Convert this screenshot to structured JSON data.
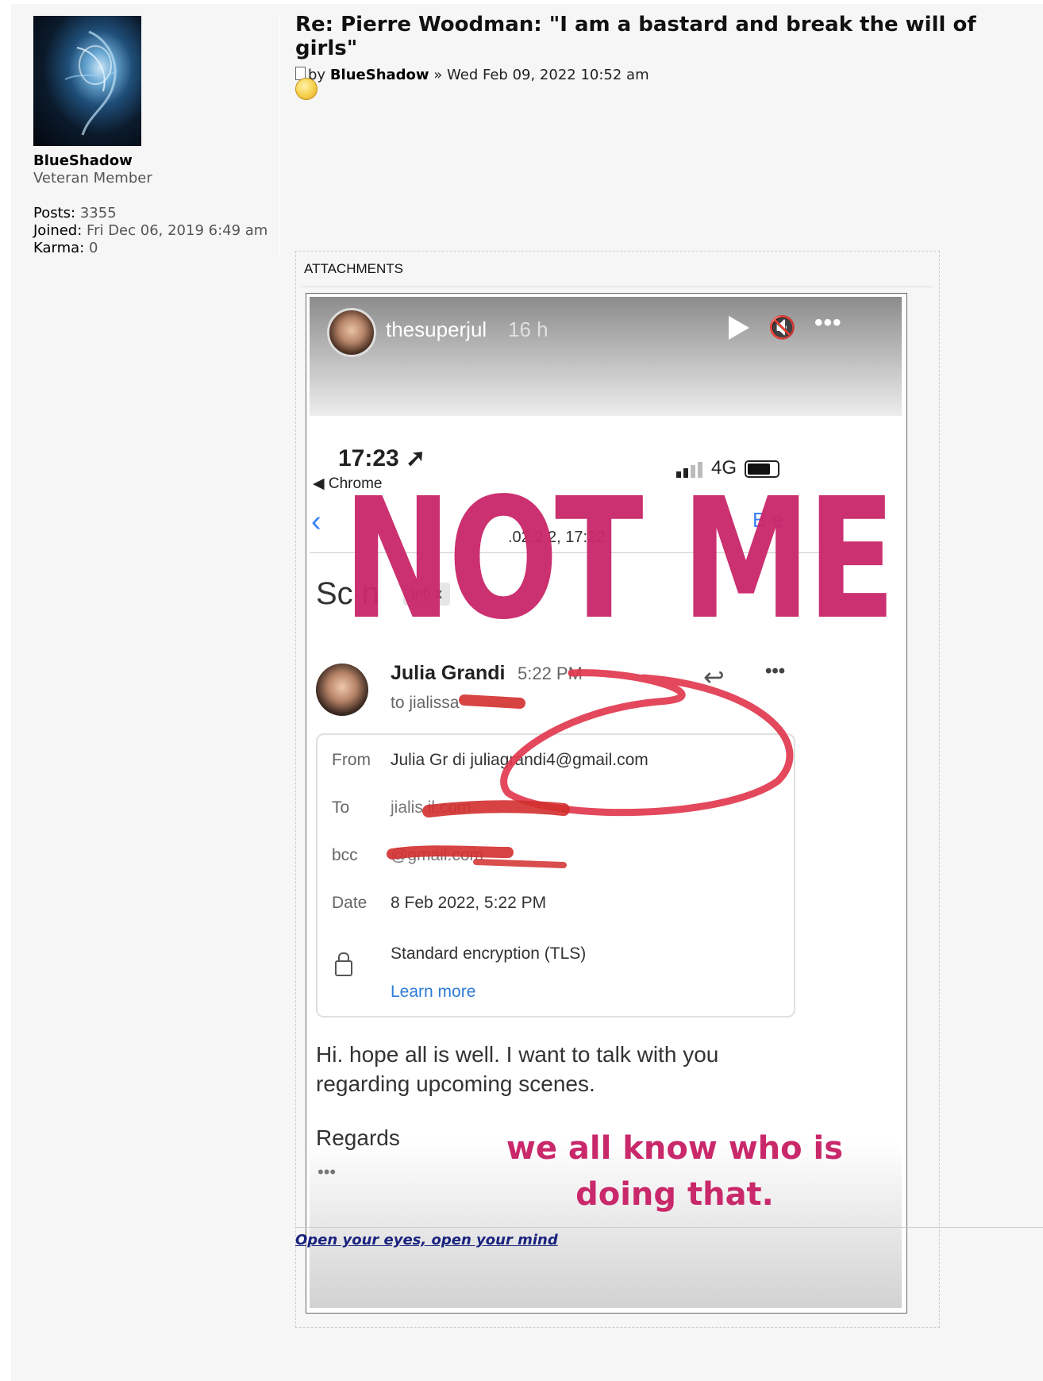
{
  "user": {
    "name": "BlueShadow",
    "rank": "Veteran Member",
    "posts_label": "Posts:",
    "posts_value": "3355",
    "joined_label": "Joined:",
    "joined_value": "Fri Dec 06, 2019 6:49 am",
    "karma_label": "Karma:",
    "karma_value": "0"
  },
  "post": {
    "title": "Re: Pierre Woodman: \"I am a bastard and break the will of girls\"",
    "by_prefix": "by",
    "author": "BlueShadow",
    "date_sep": "»",
    "date": "Wed Feb 09, 2022 10:52 am"
  },
  "attachments": {
    "label": "ATTACHMENTS",
    "story": {
      "username": "thesuperjul",
      "age": "16 h",
      "phone_time": "17:23",
      "back_app": "◀ Chrome",
      "network": "4G",
      "header_sub": ".02.2  2, 17:22",
      "header_right": "B  e",
      "subject_partial": "Sc  n",
      "inbox_tag": "Inb  x",
      "overlay": "NOT ME",
      "sender_name": "Julia Grandi",
      "sender_time": "5:22 PM",
      "to_line": "to jialissa",
      "from_label": "From",
      "from_value": "Julia Gr  di   juliagrandi4@gmail.com",
      "to_label": "To",
      "to_value": "jialis              il.com",
      "bcc_label": "bcc",
      "bcc_value": "              @gmail.com",
      "date_label": "Date",
      "date_value": "8 Feb 2022, 5:22 PM",
      "encryption": "Standard encryption (TLS)",
      "learn_more": "Learn more",
      "body": "Hi. hope all is well. I want to talk with you regarding upcoming scenes.",
      "regards": "Regards",
      "more": "•••",
      "caption": "we all know who is doing that."
    }
  },
  "signature": "Open your eyes, open your mind"
}
